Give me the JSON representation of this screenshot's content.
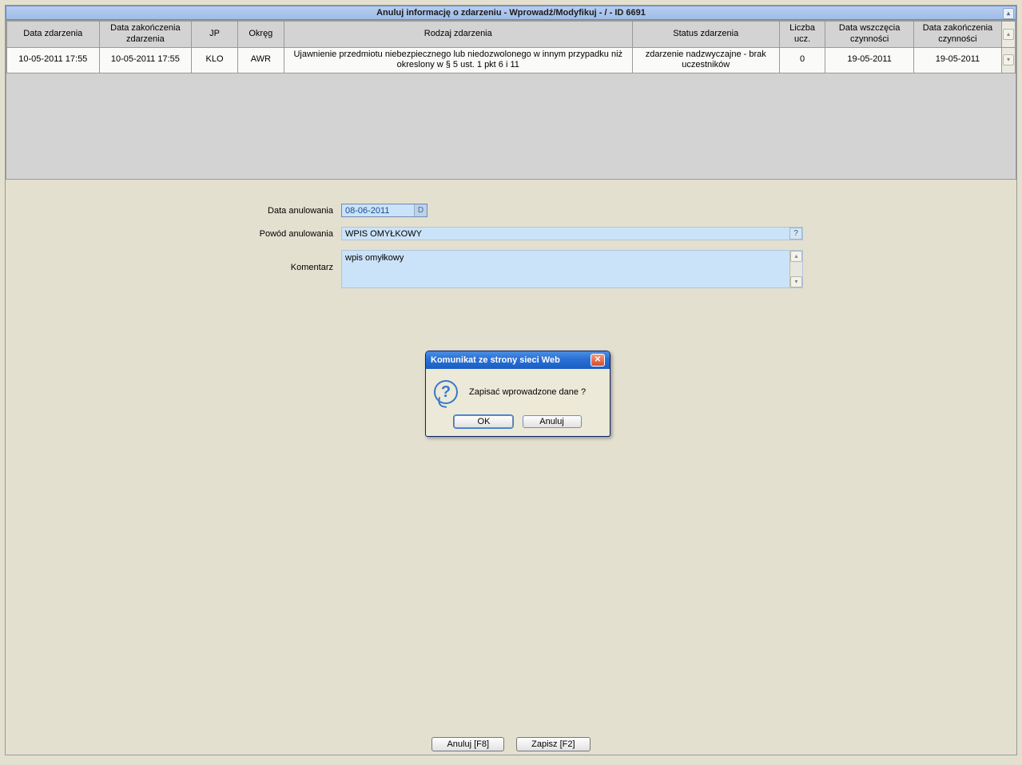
{
  "title": "Anuluj informację o zdarzeniu - Wprowadź/Modyfikuj - / - ID 6691",
  "table": {
    "headers": {
      "c1": "Data zdarzenia",
      "c2": "Data zakończenia zdarzenia",
      "c3": "JP",
      "c4": "Okręg",
      "c5": "Rodzaj zdarzenia",
      "c6": "Status zdarzenia",
      "c7": "Liczba ucz.",
      "c8": "Data wszczęcia czynności",
      "c9": "Data zakończenia czynności"
    },
    "rows": [
      {
        "c1": "10-05-2011 17:55",
        "c2": "10-05-2011 17:55",
        "c3": "KLO",
        "c4": "AWR",
        "c5": "Ujawnienie przedmiotu niebezpiecznego lub niedozwolonego w innym przypadku niż okreslony w § 5 ust. 1 pkt 6 i 11",
        "c6": "zdarzenie nadzwyczajne - brak uczestników",
        "c7": "0",
        "c8": "19-05-2011",
        "c9": "19-05-2011"
      }
    ]
  },
  "form": {
    "date_label": "Data anulowania",
    "date_value": "08-06-2011",
    "date_btn": "D",
    "reason_label": "Powód anulowania",
    "reason_value": "WPIS OMYŁKOWY",
    "reason_btn": "?",
    "comment_label": "Komentarz",
    "comment_value": "wpis omyłkowy"
  },
  "footer": {
    "cancel": "Anuluj [F8]",
    "save": "Zapisz [F2]"
  },
  "dialog": {
    "title": "Komunikat ze strony sieci Web",
    "message": "Zapisać wprowadzone dane ?",
    "ok": "OK",
    "cancel": "Anuluj"
  }
}
